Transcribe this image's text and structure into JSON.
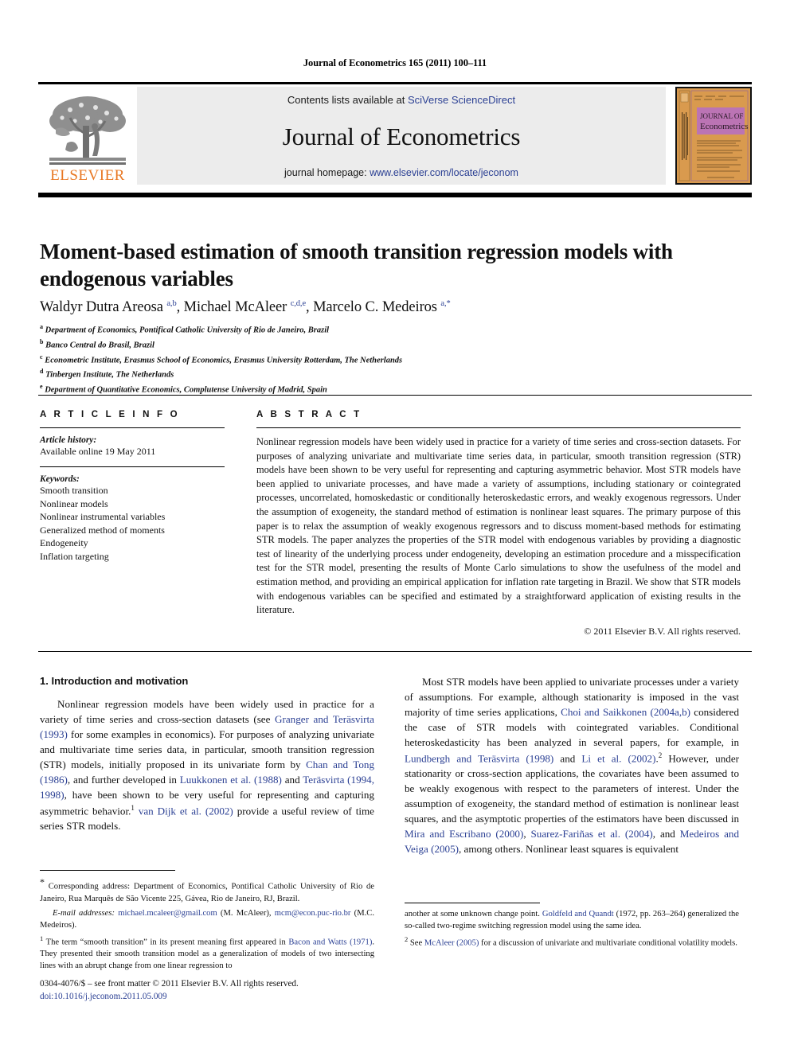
{
  "running_head": "Journal of Econometrics 165 (2011) 100–111",
  "masthead": {
    "publisher_name": "ELSEVIER",
    "contents_prefix": "Contents lists available at ",
    "contents_link": "SciVerse ScienceDirect",
    "journal_title": "Journal of Econometrics",
    "homepage_prefix": "journal homepage: ",
    "homepage_url": "www.elsevier.com/locate/jeconom",
    "cover": {
      "title_line1": "JOURNAL OF",
      "title_line2": "Econometrics",
      "bg_color": "#d99a4e",
      "title_box_color": "#bb74b4"
    },
    "logo_color": "#E87722",
    "box_bg": "#ececec"
  },
  "article": {
    "title": "Moment-based estimation of smooth transition regression models with endogenous variables",
    "authors_html": "Waldyr Dutra Areosa <sup>a,b</sup>, Michael McAleer <sup>c,d,e</sup>, Marcelo C. Medeiros <sup>a,</sup><sup class=\"star\">*</sup>",
    "affiliations": [
      {
        "marker": "a",
        "text": "Department of Economics, Pontifical Catholic University of Rio de Janeiro, Brazil"
      },
      {
        "marker": "b",
        "text": "Banco Central do Brasil, Brazil"
      },
      {
        "marker": "c",
        "text": "Econometric Institute, Erasmus School of Economics, Erasmus University Rotterdam, The Netherlands"
      },
      {
        "marker": "d",
        "text": "Tinbergen Institute, The Netherlands"
      },
      {
        "marker": "e",
        "text": "Department of Quantitative Economics, Complutense University of Madrid, Spain"
      }
    ]
  },
  "info": {
    "heading": "A R T I C L E    I N F O",
    "history_label": "Article history:",
    "history_value": "Available online 19 May 2011",
    "keywords_label": "Keywords:",
    "keywords": [
      "Smooth transition",
      "Nonlinear models",
      "Nonlinear instrumental variables",
      "Generalized method of moments",
      "Endogeneity",
      "Inflation targeting"
    ]
  },
  "abstract": {
    "heading": "A B S T R A C T",
    "text": "Nonlinear regression models have been widely used in practice for a variety of time series and cross-section datasets. For purposes of analyzing univariate and multivariate time series data, in particular, smooth transition regression (STR) models have been shown to be very useful for representing and capturing asymmetric behavior. Most STR models have been applied to univariate processes, and have made a variety of assumptions, including stationary or cointegrated processes, uncorrelated, homoskedastic or conditionally heteroskedastic errors, and weakly exogenous regressors. Under the assumption of exogeneity, the standard method of estimation is nonlinear least squares. The primary purpose of this paper is to relax the assumption of weakly exogenous regressors and to discuss moment-based methods for estimating STR models. The paper analyzes the properties of the STR model with endogenous variables by providing a diagnostic test of linearity of the underlying process under endogeneity, developing an estimation procedure and a misspecification test for the STR model, presenting the results of Monte Carlo simulations to show the usefulness of the model and estimation method, and providing an empirical application for inflation rate targeting in Brazil. We show that STR models with endogenous variables can be specified and estimated by a straightforward application of existing results in the literature.",
    "copyright": "© 2011 Elsevier B.V. All rights reserved."
  },
  "body": {
    "section_heading": "1. Introduction and motivation",
    "left_paragraph_html": "Nonlinear regression models have been widely used in practice for a variety of time series and cross-section datasets (see <span class=\"ref\">Granger and Teräsvirta (1993)</span> for some examples in economics). For purposes of analyzing univariate and multivariate time series data, in particular, smooth transition regression (STR) models, initially proposed in its univariate form by <span class=\"ref\">Chan and Tong (1986)</span>, and further developed in <span class=\"ref\">Luukkonen et al. (1988)</span> and <span class=\"ref\">Teräsvirta (1994, 1998)</span>, have been shown to be very useful for representing and capturing asymmetric behavior.<sup>1</sup> <span class=\"ref\">van Dijk et al. (2002)</span> provide a useful review of time series STR models.",
    "right_paragraph_html": "Most STR models have been applied to univariate processes under a variety of assumptions. For example, although stationarity is imposed in the vast majority of time series applications, <span class=\"ref\">Choi and Saikkonen (2004a,b)</span> considered the case of STR models with cointegrated variables. Conditional heteroskedasticity has been analyzed in several papers, for example, in <span class=\"ref\">Lundbergh and Teräsvirta (1998)</span> and <span class=\"ref\">Li et al. (2002)</span>.<sup>2</sup> However, under stationarity or cross-section applications, the  covariates have been assumed to be weakly exogenous with respect to the parameters of interest. Under the assumption of exogeneity, the standard method of estimation is nonlinear least squares, and the asymptotic properties of the estimators have been discussed in <span class=\"ref\">Mira and Escribano (2000)</span>, <span class=\"ref\">Suarez-Fariñas et al. (2004)</span>, and <span class=\"ref\">Medeiros and Veiga (2005)</span>, among others. Nonlinear least squares is equivalent"
  },
  "footnotes": {
    "left": [
      {
        "marker": "*",
        "html": "Corresponding address: Department of Economics, Pontifical Catholic University of Rio de Janeiro, Rua Marquês de São Vicente 225, Gávea, Rio de Janeiro, RJ, Brazil."
      },
      {
        "marker": "",
        "html": "<span class=\"it\">E-mail addresses:</span> <span class=\"lnk\">michael.mcaleer@gmail.com</span> (M. McAleer), <span class=\"lnk\">mcm@econ.puc-rio.br</span> (M.C. Medeiros)."
      },
      {
        "marker": "1",
        "html": "The term &ldquo;smooth transition&rdquo; in its present meaning first appeared in <span class=\"lnk\">Bacon and Watts (1971)</span>. They presented their smooth transition model as a generalization of models of two intersecting lines with an abrupt change from one linear regression to"
      }
    ],
    "right": [
      {
        "marker": "",
        "html": "another at some unknown change point. <span class=\"lnk\">Goldfeld and Quandt</span> (1972, pp. 263–264) generalized the so-called two-regime switching regression model using the same idea."
      },
      {
        "marker": "2",
        "html": "See <span class=\"lnk\">McAleer (2005)</span> for a discussion of univariate and multivariate conditional volatility models."
      }
    ]
  },
  "imprint": {
    "issn_line": "0304-4076/$ – see front matter © 2011 Elsevier B.V. All rights reserved.",
    "doi_line": "doi:10.1016/j.jeconom.2011.05.009"
  }
}
